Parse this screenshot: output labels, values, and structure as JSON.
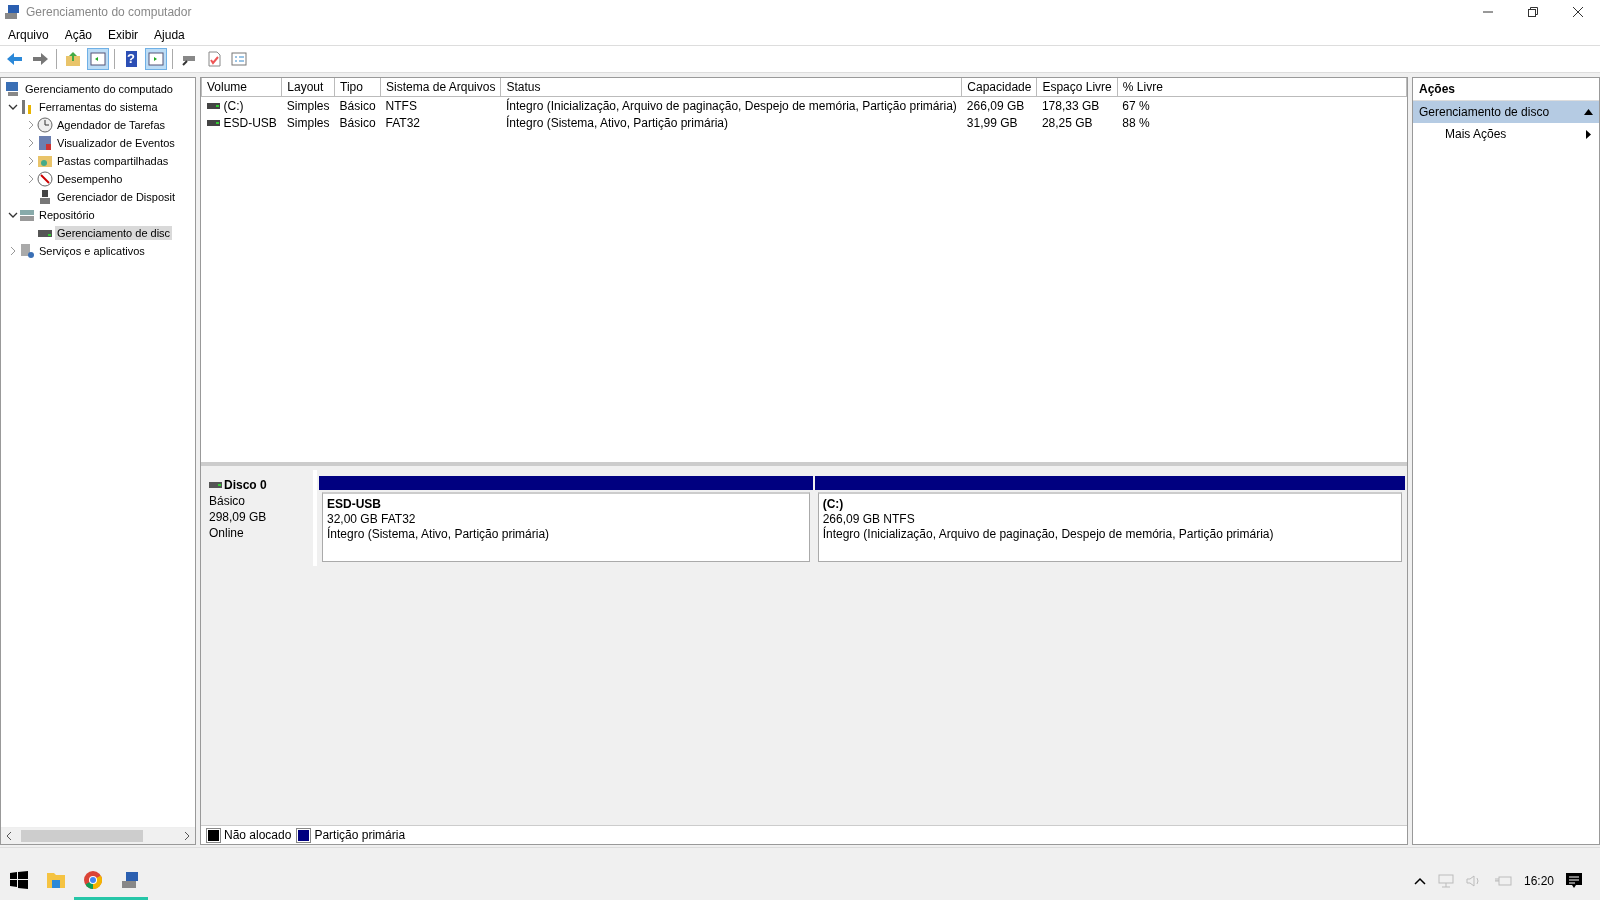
{
  "window": {
    "title": "Gerenciamento do computador"
  },
  "menu": [
    "Arquivo",
    "Ação",
    "Exibir",
    "Ajuda"
  ],
  "toolbar": [
    [
      {
        "kind": "back",
        "pressed": false
      },
      {
        "kind": "forward",
        "pressed": false
      }
    ],
    [
      {
        "kind": "up",
        "pressed": false
      },
      {
        "kind": "pane",
        "pressed": true
      }
    ],
    [
      {
        "kind": "help",
        "pressed": false,
        "glyph": "?"
      },
      {
        "kind": "pane2",
        "pressed": true
      }
    ],
    [
      {
        "kind": "connect",
        "pressed": false
      },
      {
        "kind": "check",
        "pressed": false
      },
      {
        "kind": "props",
        "pressed": false
      }
    ]
  ],
  "tree": [
    {
      "label": "Gerenciamento do computado",
      "selected": false,
      "children": [
        {
          "label": "Ferramentas do sistema",
          "expanded": true,
          "selected": false,
          "children": [
            {
              "label": "Agendador de Tarefas",
              "expanded": false,
              "selected": false
            },
            {
              "label": "Visualizador de Eventos",
              "expanded": false,
              "selected": false
            },
            {
              "label": "Pastas compartilhadas",
              "expanded": false,
              "selected": false
            },
            {
              "label": "Desempenho",
              "expanded": false,
              "selected": false
            },
            {
              "label": "Gerenciador de Disposit",
              "selected": false
            }
          ]
        },
        {
          "label": "Repositório",
          "expanded": true,
          "selected": false,
          "children": [
            {
              "label": "Gerenciamento de disc",
              "selected": true
            }
          ]
        },
        {
          "label": "Serviços e aplicativos",
          "expanded": false,
          "selected": false
        }
      ]
    }
  ],
  "table": {
    "columns": [
      "Volume",
      "Layout",
      "Tipo",
      "Sistema de Arquivos",
      "Status",
      "Capacidade",
      "Espaço Livre",
      "% Livre"
    ],
    "rows": [
      [
        "(C:)",
        "Simples",
        "Básico",
        "NTFS",
        "Íntegro (Inicialização, Arquivo de paginação, Despejo de memória, Partição primária)",
        "266,09 GB",
        "178,33 GB",
        "67 %"
      ],
      [
        "ESD-USB",
        "Simples",
        "Básico",
        "FAT32",
        "Íntegro (Sistema, Ativo, Partição primária)",
        "31,99 GB",
        "28,25 GB",
        "88 %"
      ]
    ]
  },
  "disk": {
    "name": "Disco 0",
    "type": "Básico",
    "size": "298,09 GB",
    "state": "Online",
    "partitions": [
      {
        "name": "ESD-USB",
        "size": "32,00 GB FAT32",
        "status": "Íntegro (Sistema, Ativo, Partição primária)",
        "color": "#000080"
      },
      {
        "name": "(C:)",
        "size": "266,09 GB NTFS",
        "status": "Íntegro (Inicialização, Arquivo de paginação, Despejo de memória, Partição primária)",
        "color": "#000080"
      }
    ]
  },
  "legend": [
    {
      "label": "Não alocado",
      "color": "#000000"
    },
    {
      "label": "Partição primária",
      "color": "#000080"
    }
  ],
  "actions": {
    "title": "Ações",
    "section": {
      "label": "Gerenciamento de disco",
      "expanded": true
    },
    "items": [
      "Mais Ações"
    ]
  },
  "taskbar": [
    {
      "kind": "start",
      "running": false
    },
    {
      "kind": "explorer",
      "running": false
    },
    {
      "kind": "browser",
      "running": true
    },
    {
      "kind": "compmgmt",
      "running": true
    }
  ],
  "tray": {
    "time": "16:20"
  }
}
